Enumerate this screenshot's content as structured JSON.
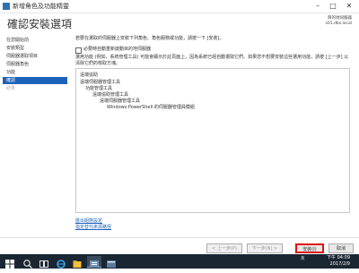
{
  "window": {
    "title": "新增角色及功能精靈",
    "heading": "確認安裝選項",
    "server_label": "目的地伺服器",
    "server_name": "s01.dbs.local",
    "minimize": "–",
    "maximize": "□",
    "close": "✕"
  },
  "sidebar": {
    "items": [
      {
        "label": "在您開始前",
        "state": "normal"
      },
      {
        "label": "安裝類型",
        "state": "normal"
      },
      {
        "label": "伺服器選取項目",
        "state": "normal"
      },
      {
        "label": "伺服器角色",
        "state": "normal"
      },
      {
        "label": "功能",
        "state": "normal"
      },
      {
        "label": "確認",
        "state": "active"
      },
      {
        "label": "結果",
        "state": "disabled"
      }
    ]
  },
  "main": {
    "description": "若要在選取的伺服器上安裝下列角色、角色服務或功能，請按一下 [安裝]。",
    "restart_checkbox_label": "必要時自動重新啟動目的地伺服器",
    "restart_checked": false,
    "notice": "選用功能 (例如，系統管理工具) 可能會顯示於此頁面上，因為系統已經自動選取它們。如果您不想要安裝這些選用功能，請按 [上一步] 以清除它們的核取方塊。",
    "features": [
      {
        "label": "遠端協助",
        "level": 0
      },
      {
        "label": "遠端伺服器管理工具",
        "level": 0
      },
      {
        "label": "功能管理工具",
        "level": 1
      },
      {
        "label": "遠端協助管理工具",
        "level": 2
      },
      {
        "label": "遠端伺服器管理工具",
        "level": 3
      },
      {
        "label": "Windows PowerShell 的伺服器管理員模組",
        "level": 4
      }
    ],
    "links": [
      "匯出組態設定",
      "指定替代來源路徑"
    ]
  },
  "buttons": {
    "previous": "< 上一步(P)",
    "next": "下一步(N) >",
    "install": "安裝(I)",
    "cancel": "取消"
  },
  "taskbar": {
    "tray": "英",
    "time": "下午 04:09",
    "date": "2017/2/9"
  },
  "colors": {
    "accent": "#1d62b8",
    "highlight_border": "#e01010",
    "taskbar": "#1b2633"
  }
}
